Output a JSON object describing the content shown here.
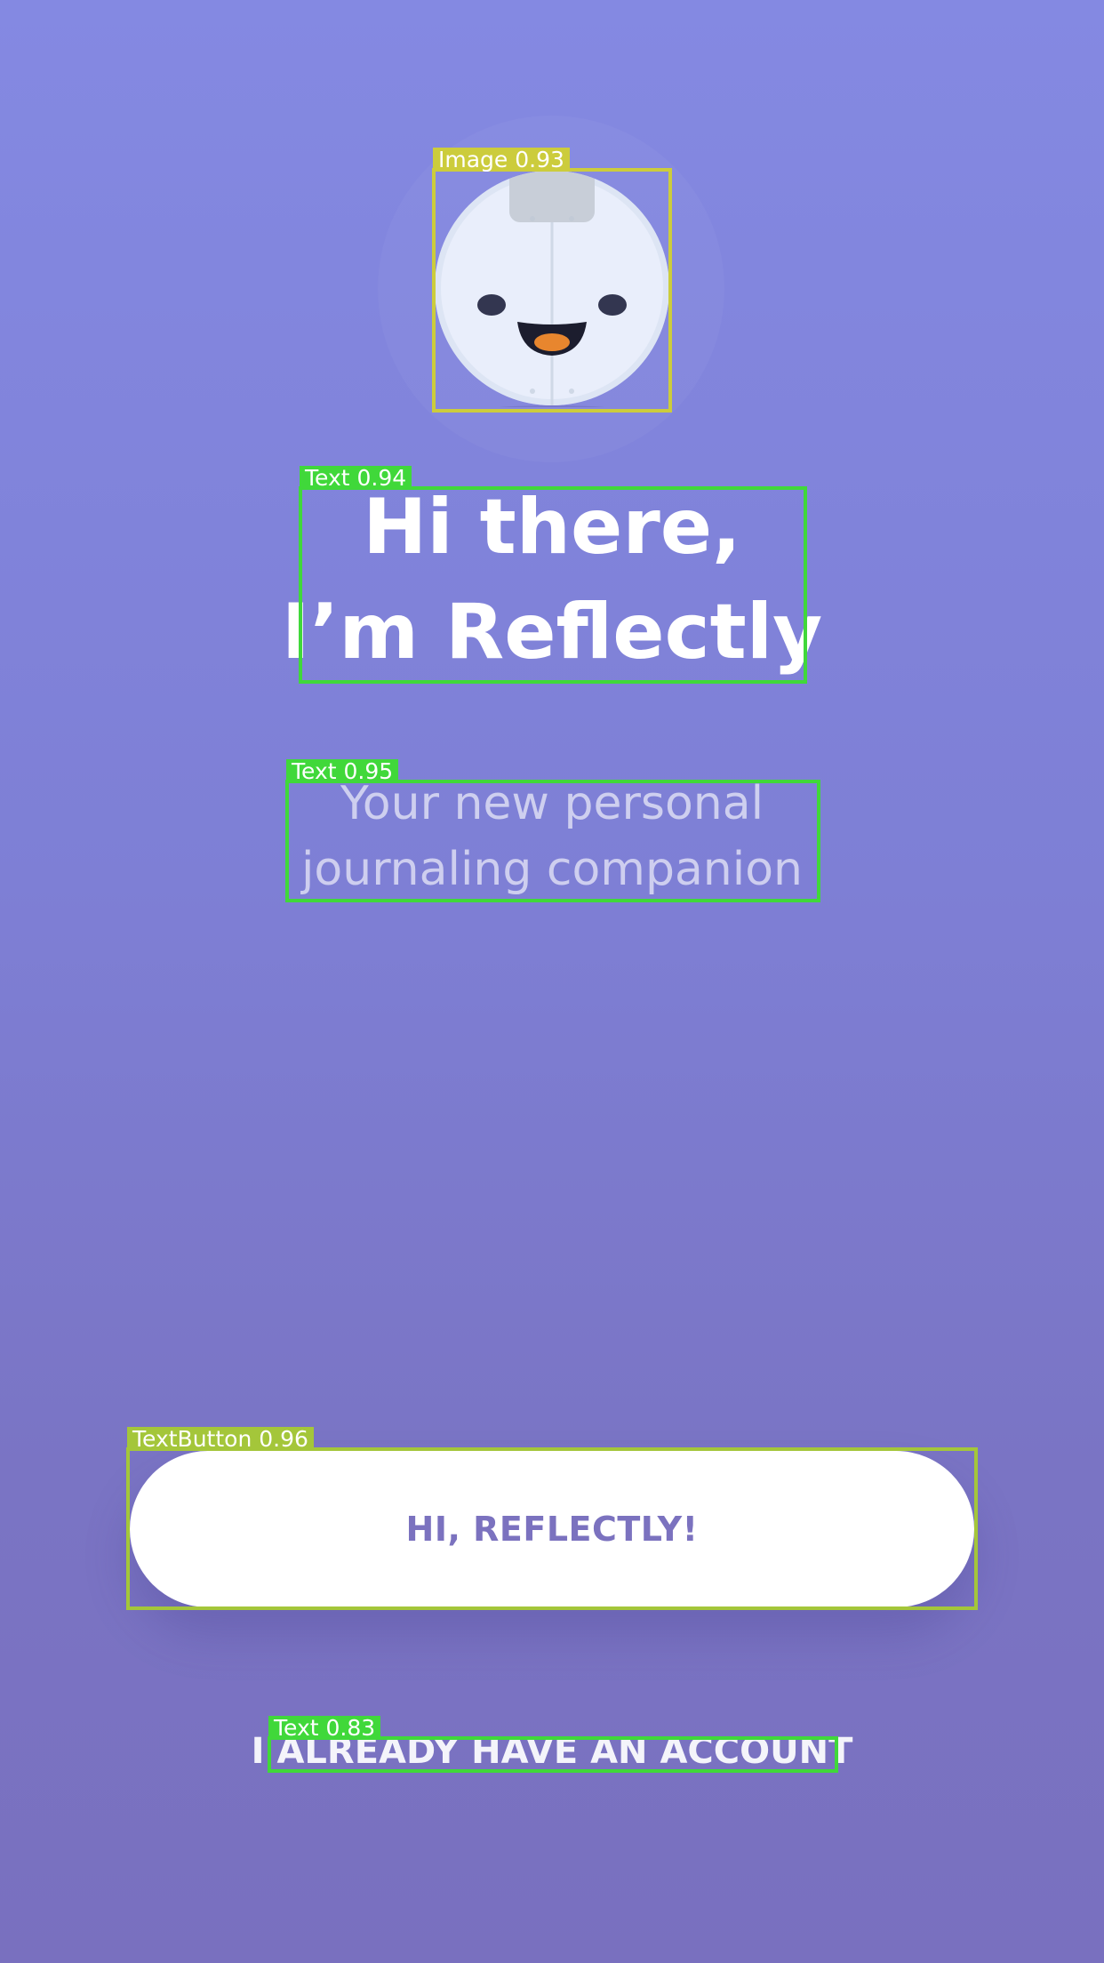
{
  "mascot": {
    "icon": "reflectly-mascot-icon"
  },
  "welcome": {
    "title_line1": "Hi there,",
    "title_line2": "I’m Reflectly",
    "subtitle_line1": "Your new personal",
    "subtitle_line2": "journaling companion"
  },
  "actions": {
    "primary_label": "HI, REFLECTLY!",
    "secondary_label": "I ALREADY HAVE AN ACCOUNT"
  },
  "detections": [
    {
      "label": "Image",
      "score": "0.93"
    },
    {
      "label": "Text",
      "score": "0.94"
    },
    {
      "label": "Text",
      "score": "0.95"
    },
    {
      "label": "TextButton",
      "score": "0.96"
    },
    {
      "label": "Text",
      "score": "0.83"
    }
  ],
  "colors": {
    "background_top": "#8489e2",
    "background_bottom": "#7970bf",
    "button_text": "#7b72bf",
    "image_box": "#cccc3c",
    "text_box": "#40d83a",
    "button_box": "#a4c63a"
  }
}
